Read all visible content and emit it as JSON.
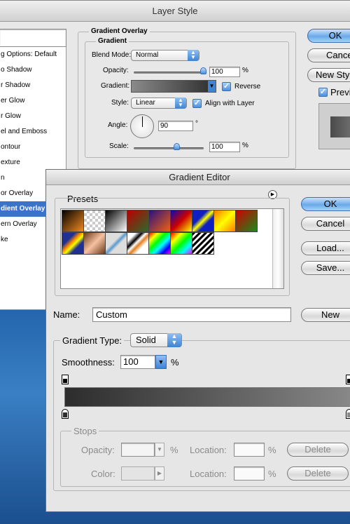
{
  "layer_style": {
    "title": "Layer Style",
    "sidebar": [
      "g Options: Default",
      "o Shadow",
      "r Shadow",
      "er Glow",
      "r Glow",
      "el and Emboss",
      "ontour",
      "exture",
      "n",
      "or Overlay",
      "dient Overlay",
      "ern Overlay",
      "ke"
    ],
    "selected_index": 10,
    "section_title": "Gradient Overlay",
    "group_title": "Gradient",
    "blend_mode_label": "Blend Mode:",
    "blend_mode_value": "Normal",
    "opacity_label": "Opacity:",
    "opacity_value": "100",
    "opacity_level": 1.0,
    "percent": "%",
    "gradient_label": "Gradient:",
    "reverse_label": "Reverse",
    "style_label": "Style:",
    "style_value": "Linear",
    "align_label": "Align with Layer",
    "angle_label": "Angle:",
    "angle_value": "90",
    "degree": "°",
    "scale_label": "Scale:",
    "scale_value": "100",
    "scale_level": 0.5,
    "ok": "OK",
    "cancel": "Cance",
    "new_style": "New Sty",
    "preview": "Previ"
  },
  "gradient_editor": {
    "title": "Gradient Editor",
    "presets_label": "Presets",
    "ok": "OK",
    "cancel": "Cancel",
    "load": "Load...",
    "save": "Save...",
    "name_label": "Name:",
    "name_value": "Custom",
    "new": "New",
    "gradient_type_label": "Gradient Type:",
    "gradient_type_value": "Solid",
    "smoothness_label": "Smoothness:",
    "smoothness_value": "100",
    "percent": "%",
    "stops_label": "Stops",
    "opacity_label": "Opacity:",
    "location_label": "Location:",
    "color_label": "Color:",
    "delete": "Delete",
    "gradient_from": "#2c2c2c",
    "gradient_to": "#8a8a8a"
  }
}
